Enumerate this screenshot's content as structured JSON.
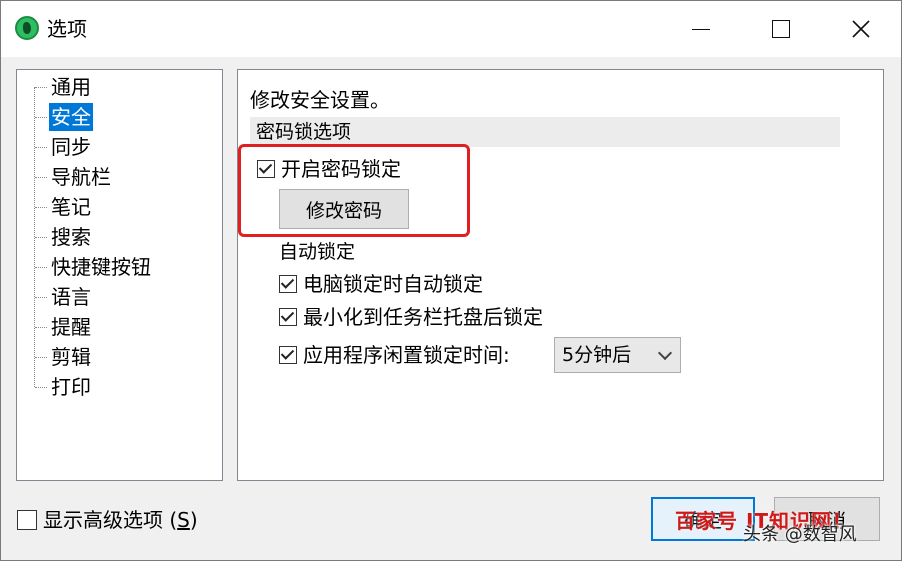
{
  "window": {
    "title": "选项",
    "icon": "evernote-app-icon",
    "controls": [
      "minimize",
      "maximize",
      "close"
    ]
  },
  "tree": {
    "items": [
      "通用",
      "安全",
      "同步",
      "导航栏",
      "笔记",
      "搜索",
      "快捷键按钮",
      "语言",
      "提醒",
      "剪辑",
      "打印"
    ],
    "selected": "安全"
  },
  "panel": {
    "heading": "修改安全设置。",
    "section_title": "密码锁选项",
    "enable_lock_label": "开启密码锁定",
    "enable_lock_checked": true,
    "change_password_label": "修改密码",
    "auto_lock_title": "自动锁定",
    "auto_lock_options": [
      {
        "label": "电脑锁定时自动锁定",
        "checked": true
      },
      {
        "label": "最小化到任务栏托盘后锁定",
        "checked": true
      },
      {
        "label": "应用程序闲置锁定时间:",
        "checked": true
      }
    ],
    "idle_time_select": "5分钟后"
  },
  "footer": {
    "advanced_label": "显示高级选项 (",
    "advanced_accel": "S",
    "advanced_suffix": ")",
    "advanced_checked": false,
    "ok_label": "确定",
    "cancel_label": "取消"
  },
  "watermark": {
    "line1": "百家号 IT知识网！",
    "line2": "头条 @数智风",
    "color": "#d01818"
  },
  "colors": {
    "selection": "#0078d7",
    "highlight_box": "#e02020",
    "default_button_border": "#0078d7"
  }
}
